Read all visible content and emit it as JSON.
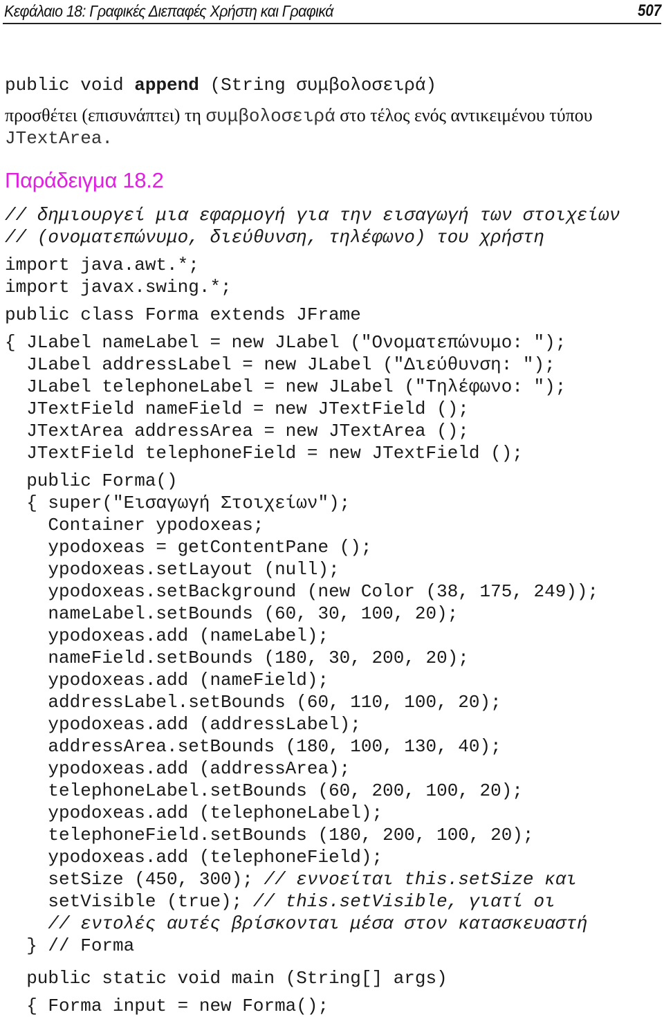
{
  "header": {
    "chapter_title": "Κεφάλαιο 18: Γραφικές Διεπαφές Χρήστη και Γραφικά",
    "page_number": "507"
  },
  "method_signature": {
    "prefix": "public void ",
    "name": "append",
    "suffix": " (String συμβολοσειρά)"
  },
  "description": {
    "part1": "προσθέτει (επισυνάπτει) τη ",
    "inline_code": "συμβολοσειρά",
    "part2": " στο τέλος ενός αντικειμένου τύπου",
    "line2": "JTextArea."
  },
  "example_heading": "Παράδειγμα 18.2",
  "code_lines": [
    {
      "code": "",
      "comment": "// δημιουργεί μια εφαρμογή για την εισαγωγή των στοιχείων"
    },
    {
      "code": "",
      "comment": "// (ονοματεπώνυμο, διεύθυνση, τηλέφωνο) του χρήστη"
    },
    {
      "code": "import java.awt.*;",
      "comment": ""
    },
    {
      "code": "import javax.swing.*;",
      "comment": ""
    },
    {
      "code": "public class Forma extends JFrame",
      "comment": ""
    },
    {
      "code": "{ JLabel nameLabel = new JLabel (\"Ονοματεπώνυμο: \");",
      "comment": ""
    },
    {
      "code": "  JLabel addressLabel = new JLabel (\"Διεύθυνση: \");",
      "comment": ""
    },
    {
      "code": "  JLabel telephoneLabel = new JLabel (\"Τηλέφωνο: \");",
      "comment": ""
    },
    {
      "code": "  JTextField nameField = new JTextField ();",
      "comment": ""
    },
    {
      "code": "  JTextArea addressArea = new JTextArea ();",
      "comment": ""
    },
    {
      "code": "  JTextField telephoneField = new JTextField ();",
      "comment": ""
    },
    {
      "code": "  public Forma()",
      "comment": ""
    },
    {
      "code": "  { super(\"Εισαγωγή Στοιχείων\");",
      "comment": ""
    },
    {
      "code": "    Container ypodoxeas;",
      "comment": ""
    },
    {
      "code": "    ypodoxeas = getContentPane ();",
      "comment": ""
    },
    {
      "code": "    ypodoxeas.setLayout (null);",
      "comment": ""
    },
    {
      "code": "    ypodoxeas.setBackground (new Color (38, 175, 249));",
      "comment": ""
    },
    {
      "code": "    nameLabel.setBounds (60, 30, 100, 20);",
      "comment": ""
    },
    {
      "code": "    ypodoxeas.add (nameLabel);",
      "comment": ""
    },
    {
      "code": "    nameField.setBounds (180, 30, 200, 20);",
      "comment": ""
    },
    {
      "code": "    ypodoxeas.add (nameField);",
      "comment": ""
    },
    {
      "code": "    addressLabel.setBounds (60, 110, 100, 20);",
      "comment": ""
    },
    {
      "code": "    ypodoxeas.add (addressLabel);",
      "comment": ""
    },
    {
      "code": "    addressArea.setBounds (180, 100, 130, 40);",
      "comment": ""
    },
    {
      "code": "    ypodoxeas.add (addressArea);",
      "comment": ""
    },
    {
      "code": "    telephoneLabel.setBounds (60, 200, 100, 20);",
      "comment": ""
    },
    {
      "code": "    ypodoxeas.add (telephoneLabel);",
      "comment": ""
    },
    {
      "code": "    telephoneField.setBounds (180, 200, 100, 20);",
      "comment": ""
    },
    {
      "code": "    ypodoxeas.add (telephoneField);",
      "comment": ""
    },
    {
      "code": "    setSize (450, 300); ",
      "comment": "// εννοείται this.setSize και"
    },
    {
      "code": "    setVisible (true); ",
      "comment": "// this.setVisible, γιατί οι"
    },
    {
      "code": "    ",
      "comment": "// εντολές αυτές βρίσκονται μέσα στον κατασκευαστή"
    },
    {
      "code": "  } // Forma",
      "comment": ""
    },
    {
      "code": "  public static void main (String[] args)",
      "comment": ""
    },
    {
      "code": "  { Forma input = new Forma();",
      "comment": ""
    }
  ]
}
